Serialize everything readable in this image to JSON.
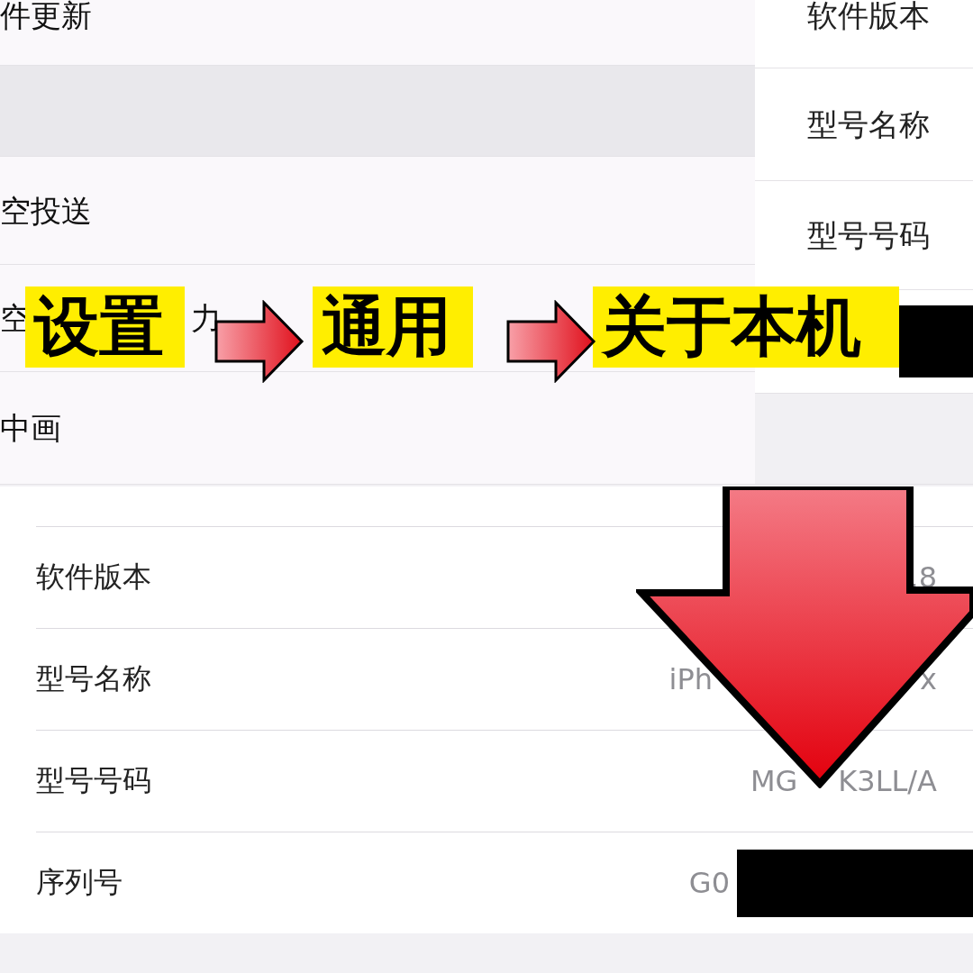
{
  "left_panel": {
    "rows": [
      {
        "kind": "text",
        "fragments": [
          "件更新"
        ]
      },
      {
        "kind": "blank"
      },
      {
        "kind": "text",
        "fragments": [
          "空投送"
        ]
      },
      {
        "kind": "text",
        "fragments": [
          "空",
          "力"
        ]
      },
      {
        "kind": "text",
        "fragments": [
          "中画"
        ]
      }
    ]
  },
  "right_panel": {
    "rows": [
      {
        "kind": "text",
        "label": "软件版本"
      },
      {
        "kind": "text",
        "label": "型号名称"
      },
      {
        "kind": "text",
        "label": "型号号码"
      },
      {
        "kind": "redacted"
      },
      {
        "kind": "blank"
      }
    ]
  },
  "steps": [
    "设置",
    "通用",
    "关于本机"
  ],
  "about_list": {
    "rows": [
      {
        "label": "软件版本",
        "value": [
          ".8"
        ],
        "redacted": false
      },
      {
        "label": "型号名称",
        "value": [
          "iPh",
          "x"
        ],
        "redacted": false
      },
      {
        "label": "型号号码",
        "value": [
          "MG",
          "K3LL/A"
        ],
        "redacted": false
      },
      {
        "label": "序列号",
        "value": [
          "G0"
        ],
        "redacted": true
      }
    ]
  }
}
